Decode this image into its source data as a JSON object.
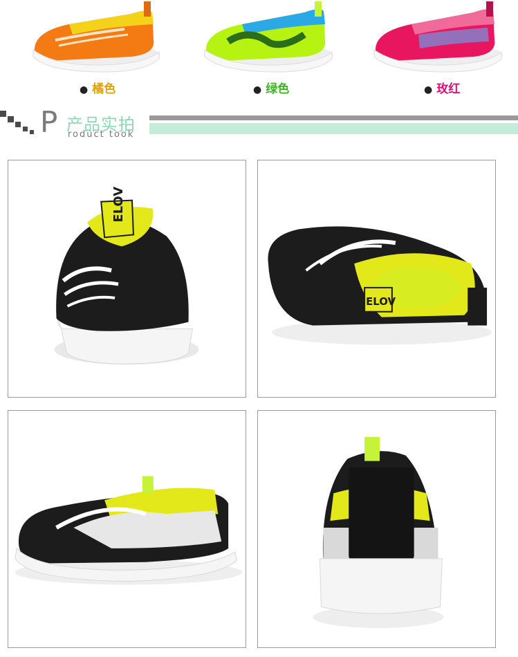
{
  "colors": [
    {
      "name": "橘色",
      "upper": "#f47b13",
      "accent": "#f4d21a",
      "text_color": "#e0a400"
    },
    {
      "name": "绿色",
      "upper": "#b6f212",
      "accent": "#2aa9e6",
      "text_color": "#3fb51e"
    },
    {
      "name": "玫红",
      "upper": "#e8155f",
      "accent": "#7a8fd8",
      "text_color": "#d8127a"
    }
  ],
  "section": {
    "letter": "P",
    "title": "产品实拍",
    "subtitle": "roduct took"
  },
  "photos": [
    {
      "view": "front",
      "icon": "shoe-front-photo"
    },
    {
      "view": "side-inside",
      "icon": "shoe-top-side-photo"
    },
    {
      "view": "side",
      "icon": "shoe-side-photo"
    },
    {
      "view": "back",
      "icon": "shoe-back-photo"
    }
  ],
  "brand_tab": "ELOV",
  "accent_colors": {
    "black": "#1c1c1c",
    "yellow": "#e3e81a",
    "sole": "#f3f3f3"
  }
}
